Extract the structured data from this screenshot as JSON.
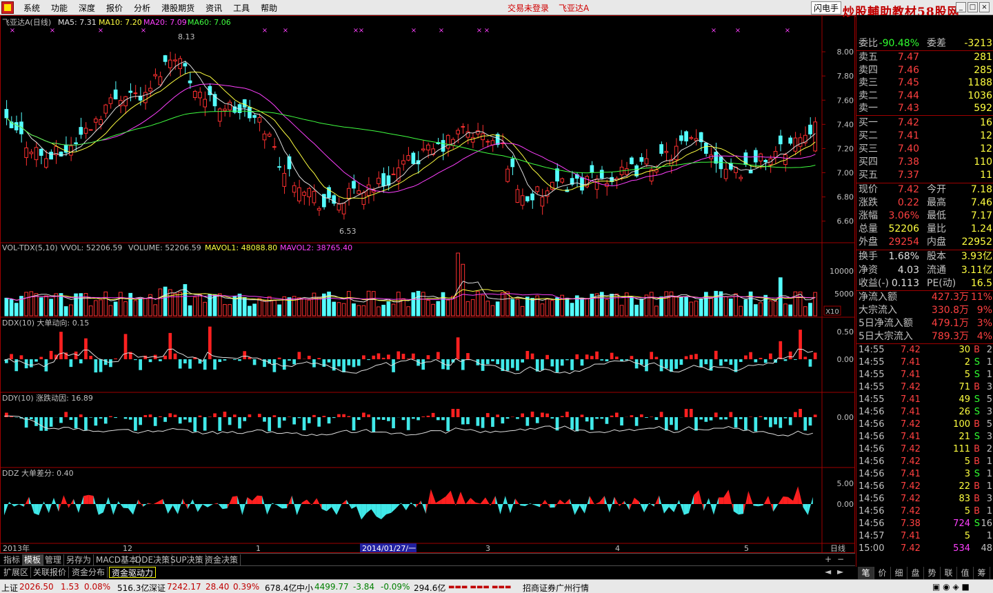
{
  "menubar": {
    "items": [
      "系统",
      "功能",
      "深度",
      "报价",
      "分析",
      "港股期货",
      "资讯",
      "工具",
      "帮助"
    ],
    "login_status": "交易未登录",
    "stock_title": "飞亚达A",
    "flash_label": "闪电手",
    "watermark": "炒股輔助教材58股网"
  },
  "main_chart": {
    "legend": {
      "name": "飞亚达A(日线)",
      "ma5": "MA5: 7.31",
      "ma10": "MA10: 7.20",
      "ma20": "MA20: 7.09",
      "ma60": "MA60: 7.06"
    },
    "high_label": "8.13",
    "low_label": "6.53",
    "price_ticks": [
      "8.00",
      "7.80",
      "7.60",
      "7.40",
      "7.20",
      "7.00",
      "6.80",
      "6.60"
    ],
    "vol_legend": {
      "name": "VOL-TDX(5,10)",
      "vvol": "VVOL: 52206.59",
      "volume": "VOLUME: 52206.59",
      "mavol1": "MAVOL1: 48088.80",
      "mavol2": "MAVOL2: 38765.40"
    },
    "vol_ticks": [
      "10000",
      "5000"
    ],
    "vol_unit": "X10",
    "ddx_legend": "DDX(10) 大单动向: 0.15",
    "ddx_ticks": [
      "0.50",
      "0.00"
    ],
    "ddy_legend": "DDY(10) 涨跌动因: 16.89",
    "ddy_ticks": [
      "0.00"
    ],
    "ddz_legend": "DDZ 大单差分: 0.40",
    "ddz_ticks": [
      "5.00",
      "0.00"
    ],
    "date_labels": [
      "2013年",
      "12",
      "1",
      "2014/01/27/一",
      "3",
      "4",
      "5"
    ],
    "period": "日线",
    "chart_data": {
      "type": "candlestick",
      "price_range": [
        6.45,
        8.2
      ],
      "ma_lines": [
        "MA5",
        "MA10",
        "MA20",
        "MA60"
      ],
      "last_close": 7.42
    }
  },
  "quote": {
    "webi_label": "委比",
    "webi": "-90.48%",
    "weicha_label": "委差",
    "weicha": "-3213",
    "asks": [
      {
        "label": "卖五",
        "price": "7.47",
        "vol": "281"
      },
      {
        "label": "卖四",
        "price": "7.46",
        "vol": "285"
      },
      {
        "label": "卖三",
        "price": "7.45",
        "vol": "1188"
      },
      {
        "label": "卖二",
        "price": "7.44",
        "vol": "1036"
      },
      {
        "label": "卖一",
        "price": "7.43",
        "vol": "592"
      }
    ],
    "bids": [
      {
        "label": "买一",
        "price": "7.42",
        "vol": "16"
      },
      {
        "label": "买二",
        "price": "7.41",
        "vol": "12"
      },
      {
        "label": "买三",
        "price": "7.40",
        "vol": "12"
      },
      {
        "label": "买四",
        "price": "7.38",
        "vol": "110"
      },
      {
        "label": "买五",
        "price": "7.37",
        "vol": "11"
      }
    ],
    "stats": [
      {
        "l1": "现价",
        "v1": "7.42",
        "c1": "red",
        "l2": "今开",
        "v2": "7.18",
        "c2": "red"
      },
      {
        "l1": "涨跌",
        "v1": "0.22",
        "c1": "red",
        "l2": "最高",
        "v2": "7.46",
        "c2": "red"
      },
      {
        "l1": "涨幅",
        "v1": "3.06%",
        "c1": "red",
        "l2": "最低",
        "v2": "7.17",
        "c2": "red"
      },
      {
        "l1": "总量",
        "v1": "52206",
        "c1": "yel",
        "l2": "量比",
        "v2": "1.24",
        "c2": "red"
      },
      {
        "l1": "外盘",
        "v1": "29254",
        "c1": "red",
        "l2": "内盘",
        "v2": "22952",
        "c2": "grn"
      }
    ],
    "fin": [
      {
        "l1": "换手",
        "v1": "1.68%",
        "l2": "股本",
        "v2": "3.93亿"
      },
      {
        "l1": "净资",
        "v1": "4.03",
        "l2": "流通",
        "v2": "3.11亿"
      },
      {
        "l1": "收益(-)",
        "v1": "0.113",
        "l2": "PE(动)",
        "v2": "16.5"
      }
    ],
    "flows": [
      {
        "label": "净流入额",
        "amount": "427.3万",
        "pct": "11%"
      },
      {
        "label": "大宗流入",
        "amount": "330.8万",
        "pct": "9%"
      },
      {
        "label": "5日净流入额",
        "amount": "479.1万",
        "pct": "3%"
      },
      {
        "label": "5日大宗流入",
        "amount": "789.3万",
        "pct": "4%"
      }
    ],
    "ticks": [
      {
        "time": "14:55",
        "price": "7.42",
        "vol": "30",
        "bs": "B",
        "n": "2"
      },
      {
        "time": "14:55",
        "price": "7.41",
        "vol": "2",
        "bs": "S",
        "n": "1"
      },
      {
        "time": "14:55",
        "price": "7.41",
        "vol": "5",
        "bs": "S",
        "n": "1"
      },
      {
        "time": "14:55",
        "price": "7.42",
        "vol": "71",
        "bs": "B",
        "n": "3"
      },
      {
        "time": "14:55",
        "price": "7.41",
        "vol": "49",
        "bs": "S",
        "n": "5"
      },
      {
        "time": "14:56",
        "price": "7.41",
        "vol": "26",
        "bs": "S",
        "n": "3"
      },
      {
        "time": "14:56",
        "price": "7.42",
        "vol": "100",
        "bs": "B",
        "n": "5"
      },
      {
        "time": "14:56",
        "price": "7.41",
        "vol": "21",
        "bs": "S",
        "n": "3"
      },
      {
        "time": "14:56",
        "price": "7.42",
        "vol": "111",
        "bs": "B",
        "n": "2"
      },
      {
        "time": "14:56",
        "price": "7.42",
        "vol": "5",
        "bs": "B",
        "n": "1"
      },
      {
        "time": "14:56",
        "price": "7.41",
        "vol": "3",
        "bs": "S",
        "n": "1"
      },
      {
        "time": "14:56",
        "price": "7.42",
        "vol": "22",
        "bs": "B",
        "n": "1"
      },
      {
        "time": "14:56",
        "price": "7.42",
        "vol": "83",
        "bs": "B",
        "n": "3"
      },
      {
        "time": "14:56",
        "price": "7.42",
        "vol": "5",
        "bs": "B",
        "n": "1"
      },
      {
        "time": "14:56",
        "price": "7.38",
        "vol": "724",
        "bs": "S",
        "n": "16"
      },
      {
        "time": "14:57",
        "price": "7.41",
        "vol": "5",
        "bs": "",
        "n": "1"
      },
      {
        "time": "15:00",
        "price": "7.42",
        "vol": "534",
        "bs": "",
        "n": "48"
      }
    ],
    "tabs": [
      "笔",
      "价",
      "细",
      "盘",
      "势",
      "联",
      "值",
      "筹"
    ]
  },
  "tabs_row1": [
    "指标",
    "模板",
    "管理",
    "另存为",
    "MACD基本",
    "DDE决策",
    "SUP决策",
    "资金决策"
  ],
  "tabs_row2": [
    "扩展区",
    "关联报价",
    "资金分布",
    "资金驱动力"
  ],
  "statusbar": {
    "sh_label": "上证",
    "sh_index": "2026.50",
    "sh_chg": "1.53",
    "sh_pct": "0.08%",
    "sh_amt": "516.3亿",
    "sz_label": "深证",
    "sz_index": "7242.17",
    "sz_chg": "28.40",
    "sz_pct": "0.39%",
    "sz_amt": "678.4亿",
    "zx_label": "中小",
    "zx_index": "4499.77",
    "zx_chg": "-3.84",
    "zx_pct": "-0.09%",
    "zx_amt": "294.6亿",
    "broker": "招商证券广州行情"
  }
}
